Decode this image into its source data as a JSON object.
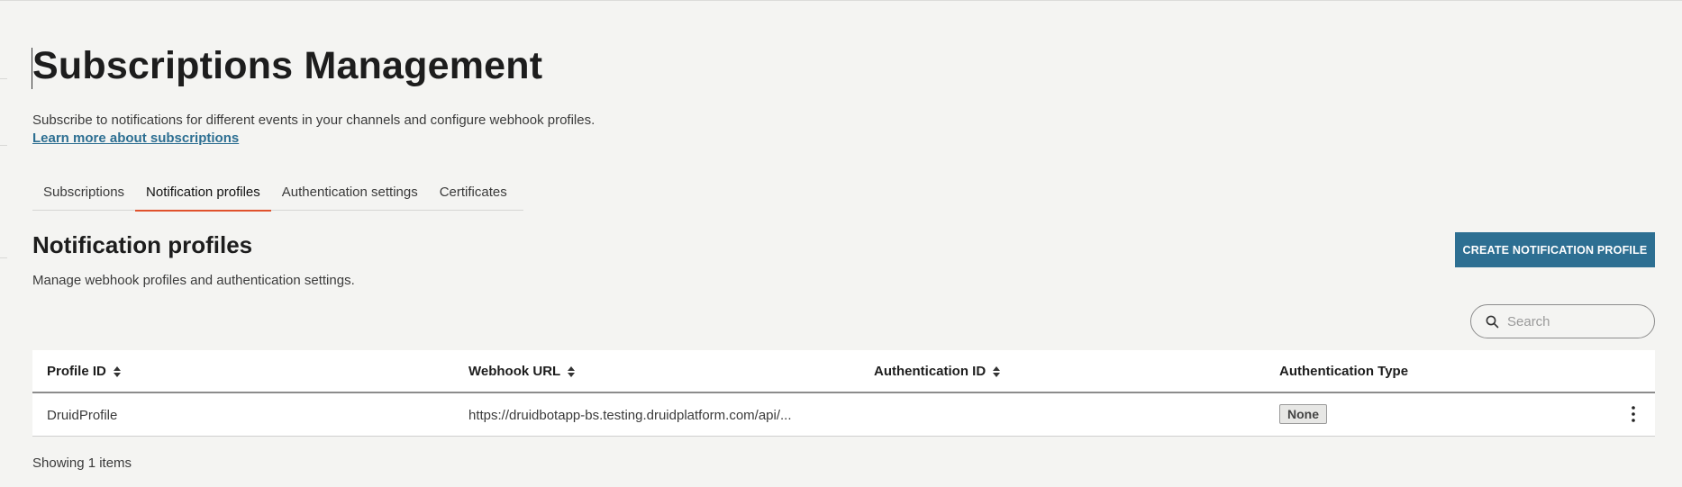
{
  "page": {
    "title": "Subscriptions Management",
    "description": "Subscribe to notifications for different events in your channels and configure webhook profiles.",
    "learn_more": "Learn more about subscriptions"
  },
  "tabs": [
    {
      "label": "Subscriptions",
      "active": false
    },
    {
      "label": "Notification profiles",
      "active": true
    },
    {
      "label": "Authentication settings",
      "active": false
    },
    {
      "label": "Certificates",
      "active": false
    }
  ],
  "section": {
    "title": "Notification profiles",
    "description": "Manage webhook profiles and authentication settings.",
    "create_button": "CREATE NOTIFICATION PROFILE"
  },
  "search": {
    "placeholder": "Search",
    "value": ""
  },
  "table": {
    "columns": [
      {
        "label": "Profile ID",
        "sortable": true
      },
      {
        "label": "Webhook URL",
        "sortable": true
      },
      {
        "label": "Authentication ID",
        "sortable": true
      },
      {
        "label": "Authentication Type",
        "sortable": false
      }
    ],
    "rows": [
      {
        "profile_id": "DruidProfile",
        "webhook_url": "https://druidbotapp-bs.testing.druidplatform.com/api/...",
        "authentication_id": "",
        "authentication_type": "None"
      }
    ],
    "footer": "Showing 1 items"
  },
  "colors": {
    "accent": "#2d6f92",
    "active_tab_underline": "#e0522d",
    "background": "#f4f4f2"
  },
  "icons": {
    "search": "search-icon",
    "sort": "sort-icon",
    "row_menu": "kebab-menu-icon"
  }
}
